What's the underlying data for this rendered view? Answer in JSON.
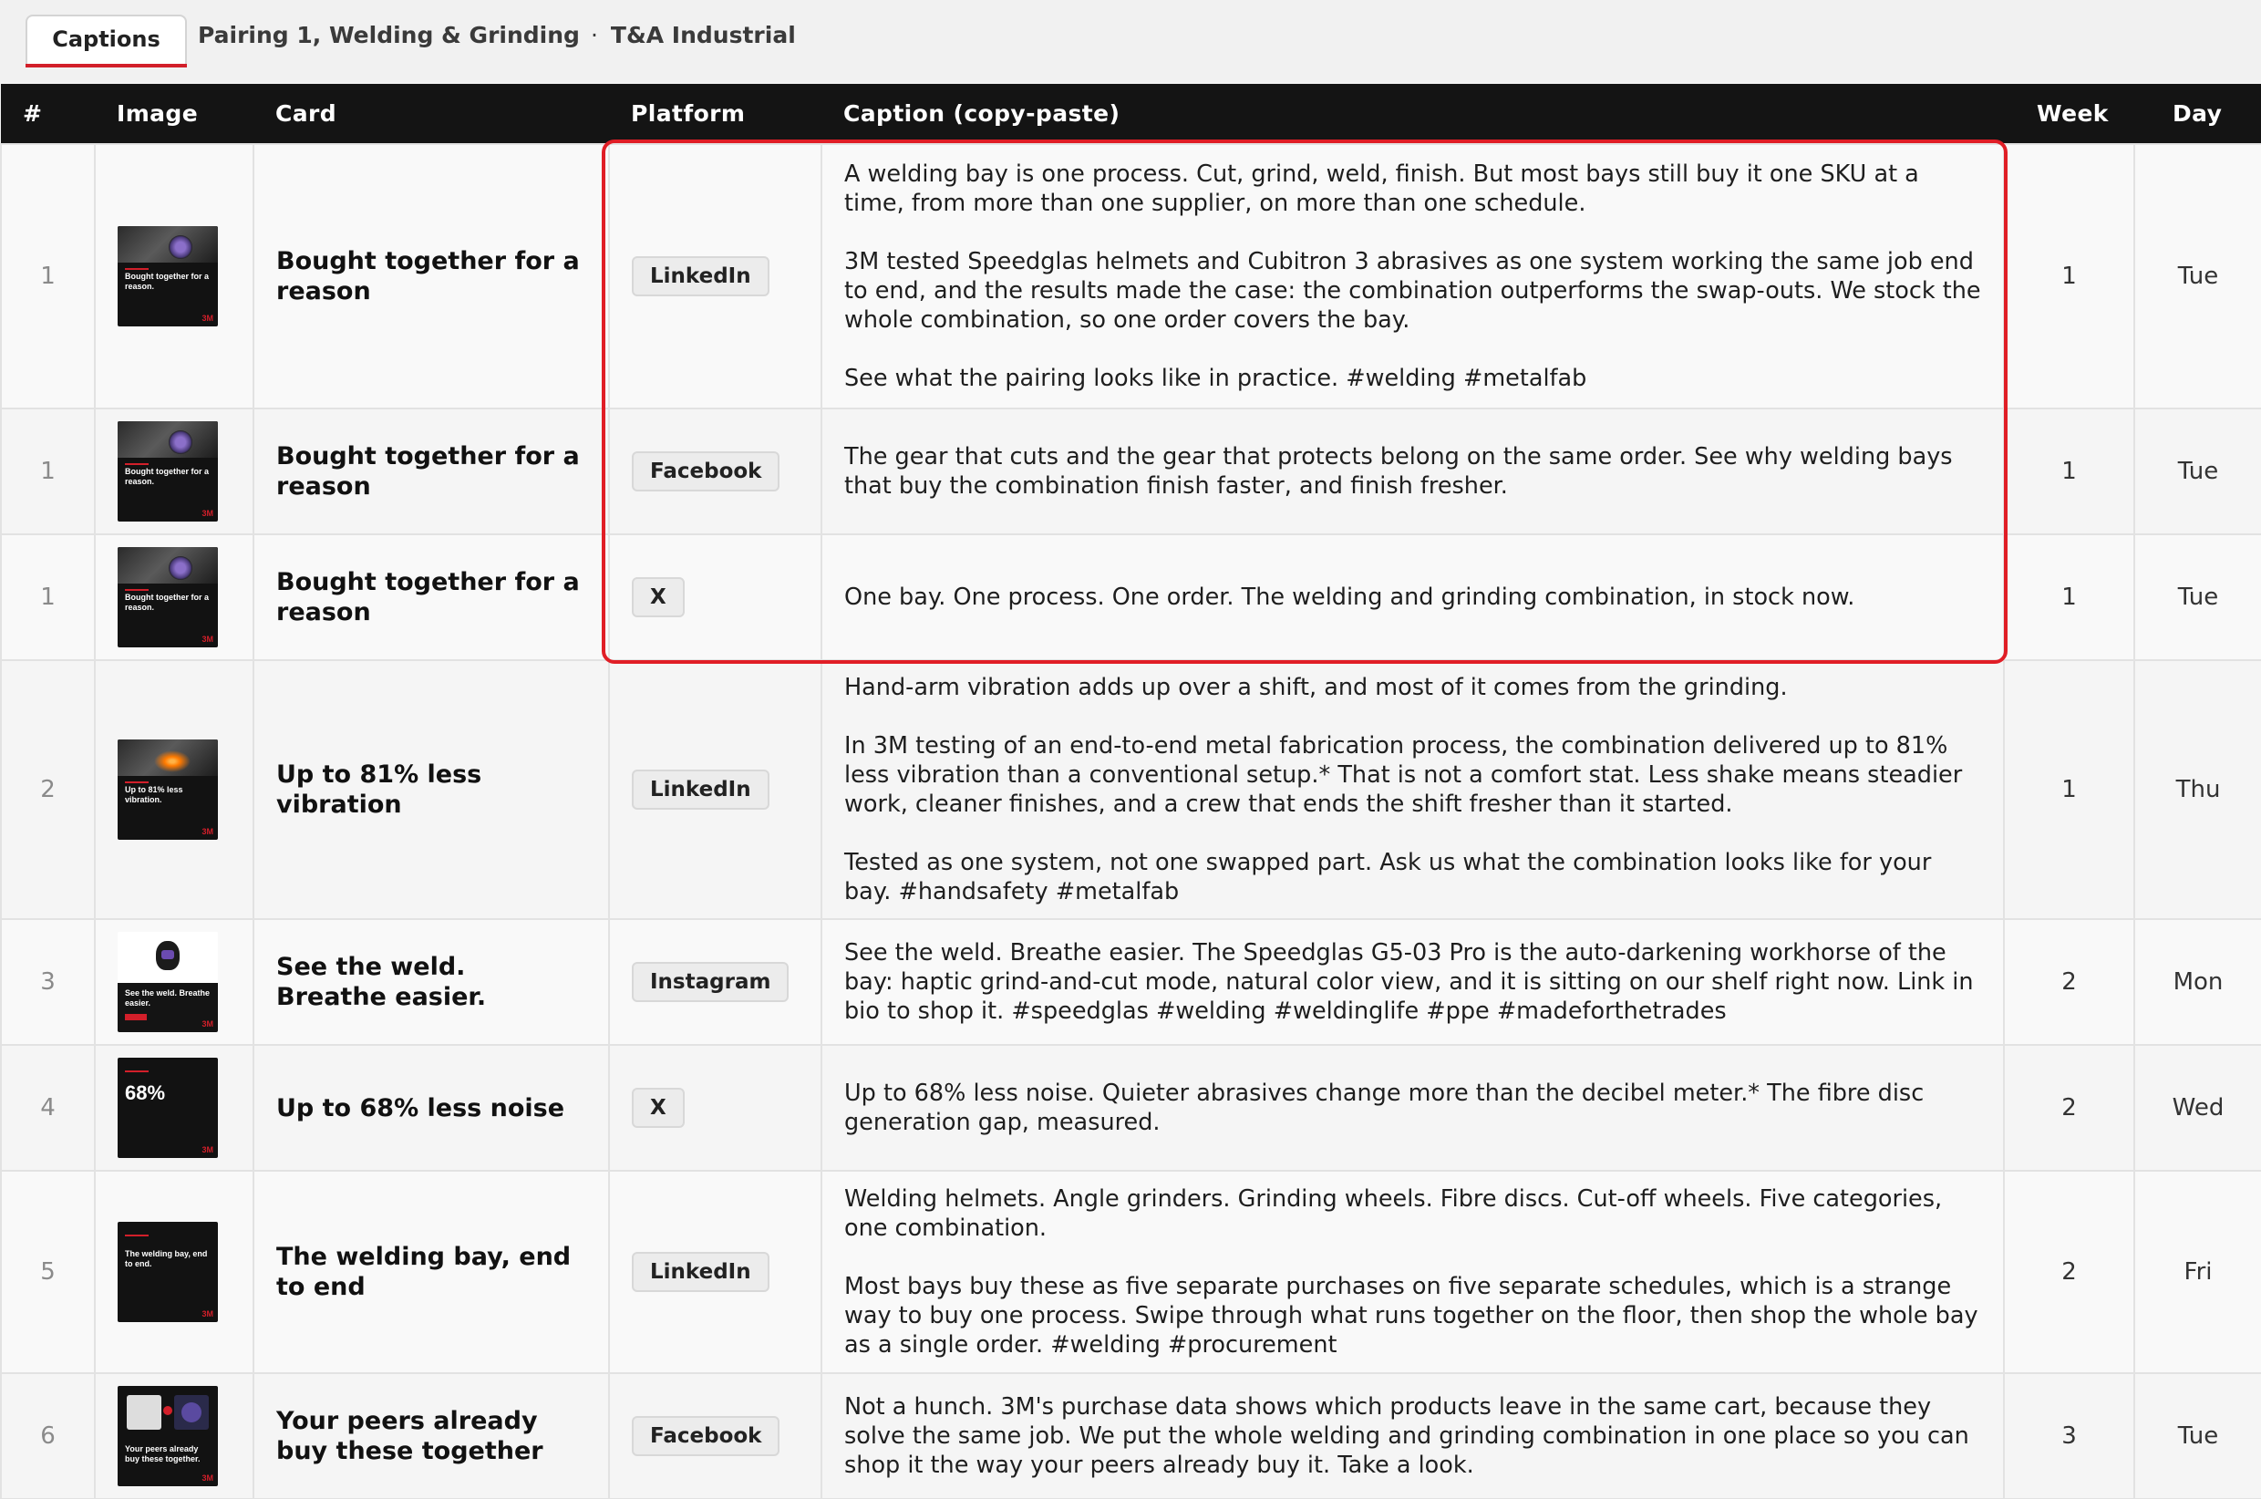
{
  "tab": {
    "label": "Captions"
  },
  "breadcrumb": {
    "campaign": "Pairing 1, Welding & Grinding",
    "separator": "·",
    "client": "T&A Industrial"
  },
  "columns": [
    "#",
    "Image",
    "Card",
    "Platform",
    "Caption (copy-paste)",
    "Week",
    "Day"
  ],
  "rows": [
    {
      "num": "1",
      "thumb_text": "Bought together for a reason.",
      "card": "Bought together for a reason",
      "platform": "LinkedIn",
      "caption": [
        "A welding bay is one process. Cut, grind, weld, finish. But most bays still buy it one SKU at a time, from more than one supplier, on more than one schedule.",
        "3M tested Speedglas helmets and Cubitron 3 abrasives as one system working the same job end to end, and the results made the case: the combination outperforms the swap-outs. We stock the whole combination, so one order covers the bay.",
        "See what the pairing looks like in practice. #welding #metalfab"
      ],
      "week": "1",
      "day": "Tue"
    },
    {
      "num": "1",
      "thumb_text": "Bought together for a reason.",
      "card": "Bought together for a reason",
      "platform": "Facebook",
      "caption": [
        "The gear that cuts and the gear that protects belong on the same order. See why welding bays that buy the combination finish faster, and finish fresher."
      ],
      "week": "1",
      "day": "Tue"
    },
    {
      "num": "1",
      "thumb_text": "Bought together for a reason.",
      "card": "Bought together for a reason",
      "platform": "X",
      "caption": [
        "One bay. One process. One order. The welding and grinding combination, in stock now."
      ],
      "week": "1",
      "day": "Tue"
    },
    {
      "num": "2",
      "thumb_text": "Up to 81% less vibration.",
      "card": "Up to 81% less vibration",
      "platform": "LinkedIn",
      "caption": [
        "Hand-arm vibration adds up over a shift, and most of it comes from the grinding.",
        "In 3M testing of an end-to-end metal fabrication process, the combination delivered up to 81% less vibration than a conventional setup.* That is not a comfort stat. Less shake means steadier work, cleaner finishes, and a crew that ends the shift fresher than it started.",
        "Tested as one system, not one swapped part. Ask us what the combination looks like for your bay. #handsafety #metalfab"
      ],
      "week": "1",
      "day": "Thu"
    },
    {
      "num": "3",
      "thumb_text": "See the weld. Breathe easier.",
      "card": "See the weld. Breathe easier.",
      "platform": "Instagram",
      "caption": [
        "See the weld. Breathe easier. The Speedglas G5-03 Pro is the auto-darkening workhorse of the bay: haptic grind-and-cut mode, natural color view, and it is sitting on our shelf right now. Link in bio to shop it. #speedglas #welding #weldinglife #ppe #madeforthetrades"
      ],
      "week": "2",
      "day": "Mon"
    },
    {
      "num": "4",
      "thumb_text": "68%",
      "card": "Up to 68% less noise",
      "platform": "X",
      "caption": [
        "Up to 68% less noise. Quieter abrasives change more than the decibel meter.* The fibre disc generation gap, measured."
      ],
      "week": "2",
      "day": "Wed"
    },
    {
      "num": "5",
      "thumb_text": "The welding bay, end to end.",
      "card": "The welding bay, end to end",
      "platform": "LinkedIn",
      "caption": [
        "Welding helmets. Angle grinders. Grinding wheels. Fibre discs. Cut-off wheels. Five categories, one combination.",
        "Most bays buy these as five separate purchases on five separate schedules, which is a strange way to buy one process. Swipe through what runs together on the floor, then shop the whole bay as a single order. #welding #procurement"
      ],
      "week": "2",
      "day": "Fri"
    },
    {
      "num": "6",
      "thumb_text": "Your peers already buy these together.",
      "card": "Your peers already buy these together",
      "platform": "Facebook",
      "caption": [
        "Not a hunch. 3M's purchase data shows which products leave in the same cart, because they solve the same job. We put the whole welding and grinding combination in one place so you can shop it the way your peers already buy it. Take a look."
      ],
      "week": "3",
      "day": "Tue"
    }
  ],
  "highlight_color": "#e01e26",
  "accent_color": "#d21f2a"
}
